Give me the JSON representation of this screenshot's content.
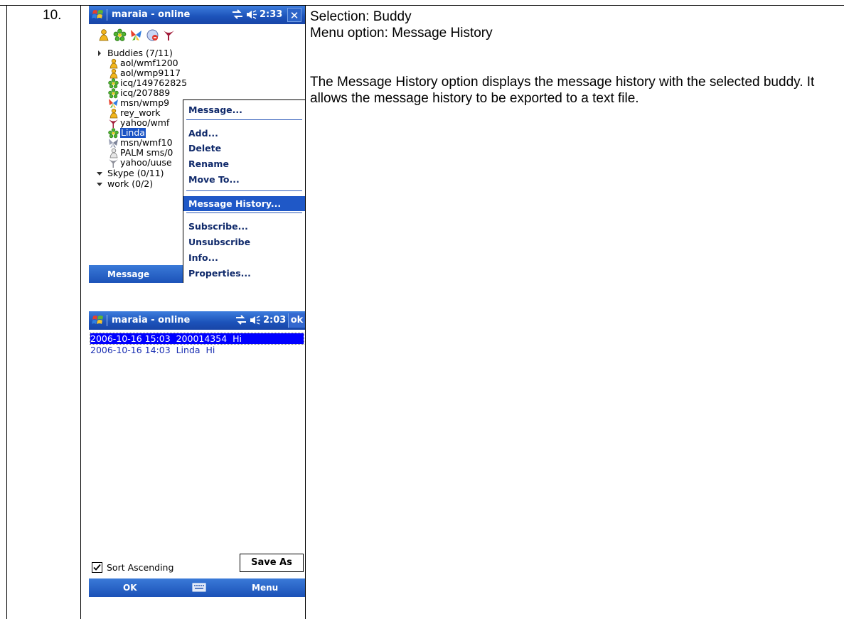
{
  "row_number": "10.",
  "description": {
    "selection": "Selection: Buddy",
    "menu_option": "Menu option: Message History",
    "body": "The Message History option displays the message history with the selected buddy. It allows the message history to be exported to a text file."
  },
  "screen1": {
    "title": "maraia - online",
    "clock": "2:33",
    "close_label": "✕",
    "toolbar_icons": [
      "aol-icon",
      "icq-icon",
      "msn-icon",
      "skype-icon",
      "yahoo-icon"
    ],
    "groups": [
      {
        "label": "Buddies (7/11)",
        "expanded": true
      },
      {
        "label": "Skype (0/11)",
        "expanded": false
      },
      {
        "label": "work (0/2)",
        "expanded": false
      }
    ],
    "buddies": [
      {
        "label": "aol/wmf1200",
        "icon": "aol-icon"
      },
      {
        "label": "aol/wmp9117",
        "icon": "aol-icon"
      },
      {
        "label": "icq/149762825",
        "icon": "icq-icon"
      },
      {
        "label": "icq/207889",
        "icon": "icq-icon"
      },
      {
        "label": "msn/wmp9",
        "icon": "msn-icon"
      },
      {
        "label": "rey_work",
        "icon": "aol-icon"
      },
      {
        "label": "yahoo/wmf",
        "icon": "yahoo-icon"
      },
      {
        "label": "Linda",
        "icon": "icq-icon",
        "selected": true
      },
      {
        "label": "msn/wmf10",
        "icon": "msn-icon"
      },
      {
        "label": "PALM sms/0",
        "icon": "person-icon"
      },
      {
        "label": "yahoo/uuse",
        "icon": "yahoo-icon"
      }
    ],
    "context_menu": [
      {
        "label": "Message...",
        "separator_after": true
      },
      {
        "label": "Add...",
        "separator_after": false
      },
      {
        "label": "Delete",
        "separator_after": false
      },
      {
        "label": "Rename",
        "separator_after": false
      },
      {
        "label": "Move To...",
        "separator_after": true
      },
      {
        "label": "Message History...",
        "separator_after": true,
        "highlighted": true
      },
      {
        "label": "Subscribe...",
        "separator_after": false
      },
      {
        "label": "Unsubscribe",
        "separator_after": false
      },
      {
        "label": "Info...",
        "separator_after": false
      },
      {
        "label": "Properties...",
        "separator_after": false
      }
    ],
    "softkey_left": "Message"
  },
  "screen2": {
    "title": "maraia - online",
    "clock": "2:03",
    "ok_label": "ok",
    "history": [
      {
        "date": "2006-10-16 15:03",
        "who": "200014354",
        "text": "Hi",
        "selected": true
      },
      {
        "date": "2006-10-16 14:03",
        "who": "Linda",
        "text": "Hi",
        "selected": false
      }
    ],
    "sort_ascending_label": "Sort Ascending",
    "sort_ascending_checked": true,
    "save_as_label": "Save As",
    "softkey_left": "OK",
    "softkey_right": "Menu"
  },
  "colors": {
    "titlebar_blue": "#1c52b9",
    "menu_highlight": "#1f58c7",
    "history_selection": "#0000ff"
  }
}
